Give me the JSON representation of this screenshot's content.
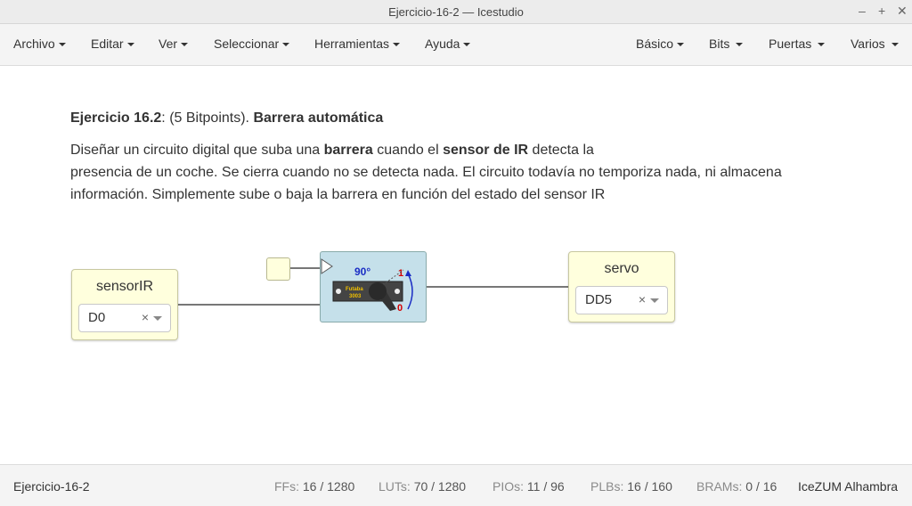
{
  "window": {
    "title": "Ejercicio-16-2 — Icestudio",
    "minimize": "–",
    "maximize": "+",
    "close": "✕"
  },
  "menu": {
    "archivo": "Archivo",
    "editar": "Editar",
    "ver": "Ver",
    "seleccionar": "Seleccionar",
    "herramientas": "Herramientas",
    "ayuda": "Ayuda",
    "basico": "Básico",
    "bits": "Bits",
    "puertas": "Puertas",
    "varios": "Varios"
  },
  "exercise": {
    "title_bold": "Ejercicio 16.2",
    "title_mid": ": (5 Bitpoints). ",
    "title_name": "Barrera automática",
    "p1": "Diseñar un circuito digital que suba una ",
    "p2": "barrera",
    "p3": " cuando el ",
    "p4": "sensor de IR",
    "p5": " detecta la",
    "p6": "presencia de un coche. Se cierra cuando no se detecta nada. El circuito todavía no temporiza nada, ni almacena información. Simplemente sube o baja la barrera en función del estado del sensor IR"
  },
  "blocks": {
    "input": {
      "name": "sensorIR",
      "pin": "D0",
      "clear": "×"
    },
    "output": {
      "name": "servo",
      "pin": "DD5",
      "clear": "×"
    },
    "servo_icon": {
      "angle": "90°",
      "top": "1",
      "bottom": "0",
      "brand": "Futaba",
      "model": "3003"
    }
  },
  "status": {
    "project": "Ejercicio-16-2",
    "ffs_label": "FFs:",
    "ffs": "16 / 1280",
    "luts_label": "LUTs:",
    "luts": "70 / 1280",
    "pios_label": "PIOs:",
    "pios": "11 / 96",
    "plbs_label": "PLBs:",
    "plbs": "16 / 160",
    "brams_label": "BRAMs:",
    "brams": "0 / 16",
    "board": "IceZUM Alhambra"
  }
}
